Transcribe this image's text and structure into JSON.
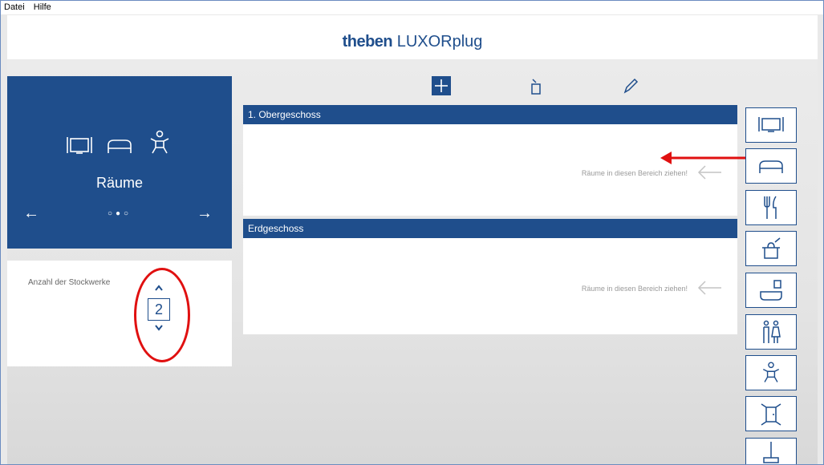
{
  "menu": {
    "file": "Datei",
    "help": "Hilfe"
  },
  "header": {
    "brand": "theben",
    "product": "LUXORplug"
  },
  "nav_panel": {
    "title": "Räume",
    "prev_arrow": "←",
    "next_arrow": "→",
    "dots": "○●○",
    "icons": [
      "tv-icon",
      "bed-icon",
      "child-icon"
    ]
  },
  "floors": {
    "label": "Anzahl der Stockwerke",
    "value": "2",
    "up": "⌃",
    "down": "⌄"
  },
  "toolbar": {
    "icons": [
      "add-icon",
      "trash-icon",
      "pencil-icon"
    ]
  },
  "sections": [
    {
      "title": "1. Obergeschoss",
      "hint": "Räume in diesen Bereich ziehen!"
    },
    {
      "title": "Erdgeschoss",
      "hint": "Räume in diesen Bereich ziehen!"
    }
  ],
  "room_palette": [
    "tv-icon",
    "bed-icon",
    "cutlery-icon",
    "pot-icon",
    "bathtub-icon",
    "toilet-icon",
    "child-icon",
    "hallway-icon",
    "lamp-icon"
  ],
  "colors": {
    "brand_blue": "#1f4e8c",
    "annotation_red": "#e01010"
  }
}
